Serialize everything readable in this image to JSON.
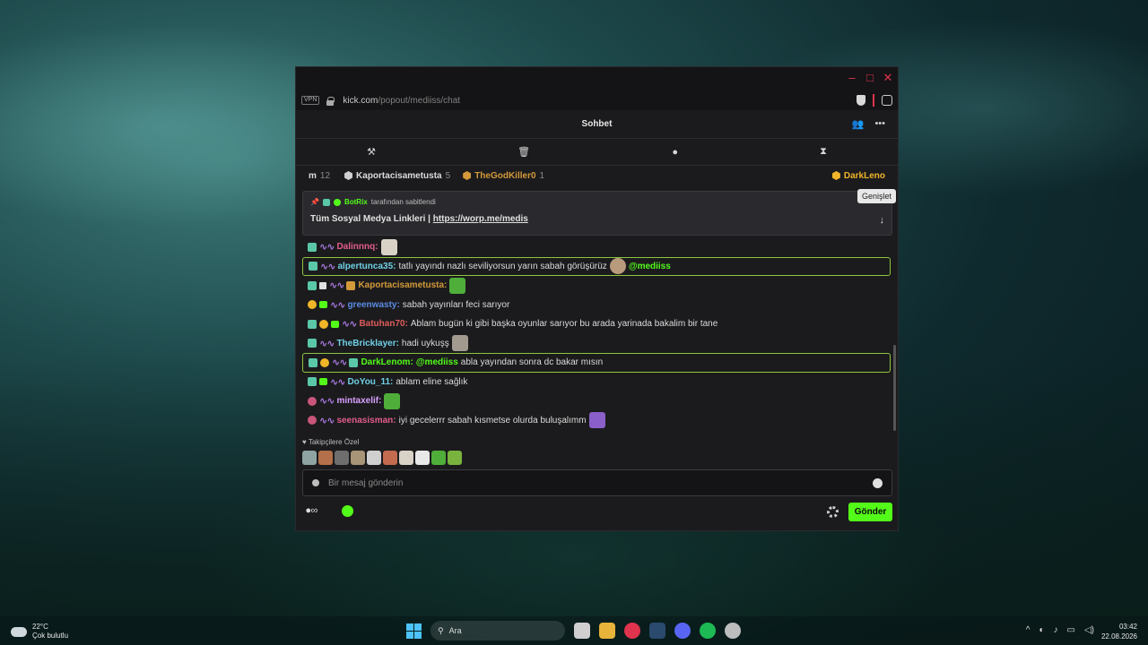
{
  "browser": {
    "vpn_label": "VPN",
    "url_host": "kick.com",
    "url_path": "/popout/mediiss/chat",
    "controls": {
      "minimize": "–",
      "maximize": "□",
      "close": "✕"
    }
  },
  "chat": {
    "title": "Sohbet",
    "mod_tools": [
      "hammer-icon",
      "trash-icon",
      "chat-bubble-icon",
      "hourglass-icon"
    ],
    "leaderboard": [
      {
        "name": "m",
        "count": "12"
      },
      {
        "name": "Kaportacisametusta",
        "count": "5"
      },
      {
        "name": "TheGodKiller0",
        "count": "1"
      },
      {
        "name": "DarkLeno",
        "count": ""
      }
    ],
    "pinned": {
      "author": "BotRix",
      "suffix": "tarafından sabitlendi",
      "message": "Tüm Sosyal Medya Linkleri | ",
      "link": "https://worp.me/medis",
      "tooltip": "Genişlet"
    },
    "messages": [
      {
        "user": "Dalinnnq:",
        "text": "",
        "color": "#e25c8e"
      },
      {
        "user": "alpertunca35:",
        "text": "tatlı yayındı nazlı seviliyorsun yarın sabah görüşürüz",
        "mention": "@mediiss",
        "color": "#6fd0e6"
      },
      {
        "user": "Kaportacisametusta:",
        "text": "",
        "color": "#d49a3a"
      },
      {
        "user": "greenwasty:",
        "text": "sabah yayınları feci sarıyor",
        "color": "#5b8be6"
      },
      {
        "user": "Batuhan70:",
        "text": "Ablam bugün ki gibi başka oyunlar sarıyor bu arada yarinada bakalim bir tane",
        "color": "#e05c5c"
      },
      {
        "user": "TheBricklayer:",
        "text": "hadi uykuşş",
        "color": "#6fd0e6"
      },
      {
        "user": "DarkLenom:",
        "mention": "@mediiss",
        "text": "abla yayından sonra dc bakar mısın",
        "color": "#53fc18"
      },
      {
        "user": "DoYou_11:",
        "text": "ablam eline sağlık",
        "color": "#6fd0e6"
      },
      {
        "user": "mintaxelif:",
        "text": "",
        "color": "#d8a0ff"
      },
      {
        "user": "seenasisman:",
        "text": "iyi gecelerrr sabah kısmetse olurda buluşalımm",
        "color": "#e25c8e"
      }
    ],
    "follower_label": "Takipçilere Özel",
    "input_placeholder": "Bir mesaj gönderin",
    "send_label": "Gönder"
  },
  "taskbar": {
    "temperature": "22°C",
    "weather": "Çok bulutlu",
    "search_placeholder": "Ara",
    "time": "03:42",
    "date": "22.08.2026"
  },
  "colors": {
    "accent": "#53fc18",
    "close_red": "#e0334d"
  }
}
